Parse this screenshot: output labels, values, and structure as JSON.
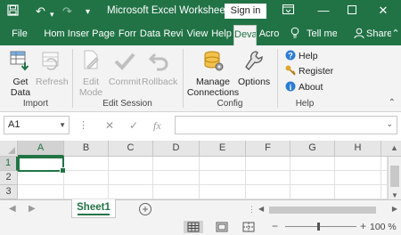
{
  "titlebar": {
    "title": "Microsoft Excel Worksheet....",
    "signin_label": "Sign in",
    "qa_icons": [
      "save-icon",
      "undo-icon",
      "redo-icon",
      "customize-qa-icon"
    ],
    "window_icons": [
      "ribbon-display-options-icon",
      "minimize-icon",
      "maximize-icon",
      "close-icon"
    ]
  },
  "tabs": [
    {
      "label": "File"
    },
    {
      "label": "Hom"
    },
    {
      "label": "Inser"
    },
    {
      "label": "Page"
    },
    {
      "label": "Forr"
    },
    {
      "label": "Data"
    },
    {
      "label": "Revi"
    },
    {
      "label": "View"
    },
    {
      "label": "Help"
    },
    {
      "label": "Deva"
    },
    {
      "label": "Acro"
    }
  ],
  "active_tab": "Deva",
  "tell_me": "Tell me",
  "share": "Share",
  "ribbon": {
    "groups": [
      {
        "name": "Import",
        "buttons": [
          {
            "label1": "Get",
            "label2": "Data",
            "icon": "get-data-icon",
            "enabled": true
          },
          {
            "label1": "Refresh",
            "label2": "",
            "icon": "refresh-icon",
            "enabled": false
          }
        ]
      },
      {
        "name": "Edit Session",
        "buttons": [
          {
            "label1": "Edit",
            "label2": "Mode",
            "icon": "edit-mode-icon",
            "enabled": false
          },
          {
            "label1": "Commit",
            "label2": "",
            "icon": "commit-icon",
            "enabled": false
          },
          {
            "label1": "Rollback",
            "label2": "",
            "icon": "rollback-icon",
            "enabled": false
          }
        ]
      },
      {
        "name": "Config",
        "buttons": [
          {
            "label1": "Manage",
            "label2": "Connections",
            "icon": "manage-connections-icon",
            "enabled": true
          },
          {
            "label1": "Options",
            "label2": "",
            "icon": "options-icon",
            "enabled": true
          }
        ]
      },
      {
        "name": "Help",
        "buttons": [
          {
            "label": "Help",
            "icon": "help-icon"
          },
          {
            "label": "Register",
            "icon": "register-icon"
          },
          {
            "label": "About",
            "icon": "about-icon"
          }
        ]
      }
    ]
  },
  "formula_bar": {
    "name_box": "A1",
    "fx": "fx",
    "value": ""
  },
  "grid": {
    "columns": [
      "A",
      "B",
      "C",
      "D",
      "E",
      "F",
      "G",
      "H"
    ],
    "rows": [
      "1",
      "2",
      "3"
    ],
    "active_cell": "A1"
  },
  "sheets": [
    {
      "name": "Sheet1",
      "active": true
    }
  ],
  "status": {
    "zoom": "100 %",
    "zoom_out": "−",
    "zoom_in": "+"
  },
  "colors": {
    "accent": "#217346",
    "ribbon_bg": "#f3f3f3",
    "disabled": "#a6a6a6"
  }
}
